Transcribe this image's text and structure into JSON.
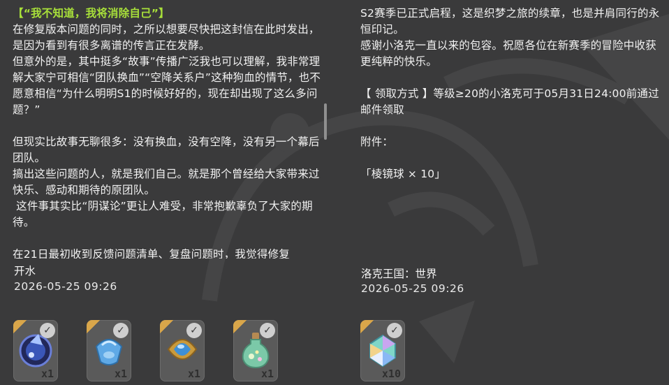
{
  "left_mail": {
    "paragraphs": [
      {
        "text": "【“我不知道，我将消除自己”】",
        "style": "title"
      },
      {
        "text": "在修复版本问题的同时，之所以想要尽快把这封信在此时发出，是因为看到有很多离谱的传言正在发酵。",
        "style": "body"
      },
      {
        "text": "但意外的是，其中挺多“故事”传播广泛我也可以理解，我非常理解大家宁可相信“团队换血”“空降关系户”这种狗血的情节，也不愿意相信“为什么明明S1的时候好好的，现在却出现了这么多问题？”",
        "style": "body"
      },
      {
        "text": "",
        "style": "blank"
      },
      {
        "text": "但现实比故事无聊很多：没有换血，没有空降，没有另一个幕后团队。",
        "style": "body"
      },
      {
        "text": "搞出这些问题的人，就是我们自己。就是那个曾经给大家带来过快乐、感动和期待的原团队。",
        "style": "body"
      },
      {
        "text": " 这件事其实比“阴谋论”更让人难受，非常抱歉辜负了大家的期待。",
        "style": "body"
      },
      {
        "text": "",
        "style": "blank"
      },
      {
        "text": "在21日最初收到反馈问题清单、复盘问题时，我觉得修复",
        "style": "body"
      }
    ],
    "sender": "开水",
    "date": "2026-05-25 09:26",
    "attachments": [
      {
        "icon": "blue-orb-icon",
        "qty": "x1"
      },
      {
        "icon": "blue-crystal-icon",
        "qty": "x1"
      },
      {
        "icon": "gold-frame-gem-icon",
        "qty": "x1"
      },
      {
        "icon": "potion-bottle-icon",
        "qty": "x1"
      }
    ]
  },
  "right_mail": {
    "paragraphs": [
      {
        "text": "S2赛季已正式启程，这是织梦之旅的续章，也是并肩同行的永恒印记。",
        "style": "body"
      },
      {
        "text": "感谢小洛克一直以来的包容。祝愿各位在新赛季的冒险中收获更纯粹的快乐。",
        "style": "body"
      },
      {
        "text": "",
        "style": "blank"
      },
      {
        "text": "【 领取方式 】等级≥20的小洛克可于05月31日24:00前通过邮件领取",
        "style": "body"
      },
      {
        "text": "",
        "style": "blank"
      },
      {
        "text": "附件：",
        "style": "body"
      },
      {
        "text": "",
        "style": "blank"
      },
      {
        "text": "「棱镜球 × 10」",
        "style": "body"
      }
    ],
    "sender": "洛克王国：世界",
    "date": "2026-05-25 09:26",
    "attachments": [
      {
        "icon": "prism-ball-icon",
        "qty": "x10"
      }
    ]
  },
  "colors": {
    "background": "#3a3a3b",
    "title_green": "#a8e03a",
    "text": "#f2f2f2",
    "rarity_gold": "#d9a64a"
  }
}
